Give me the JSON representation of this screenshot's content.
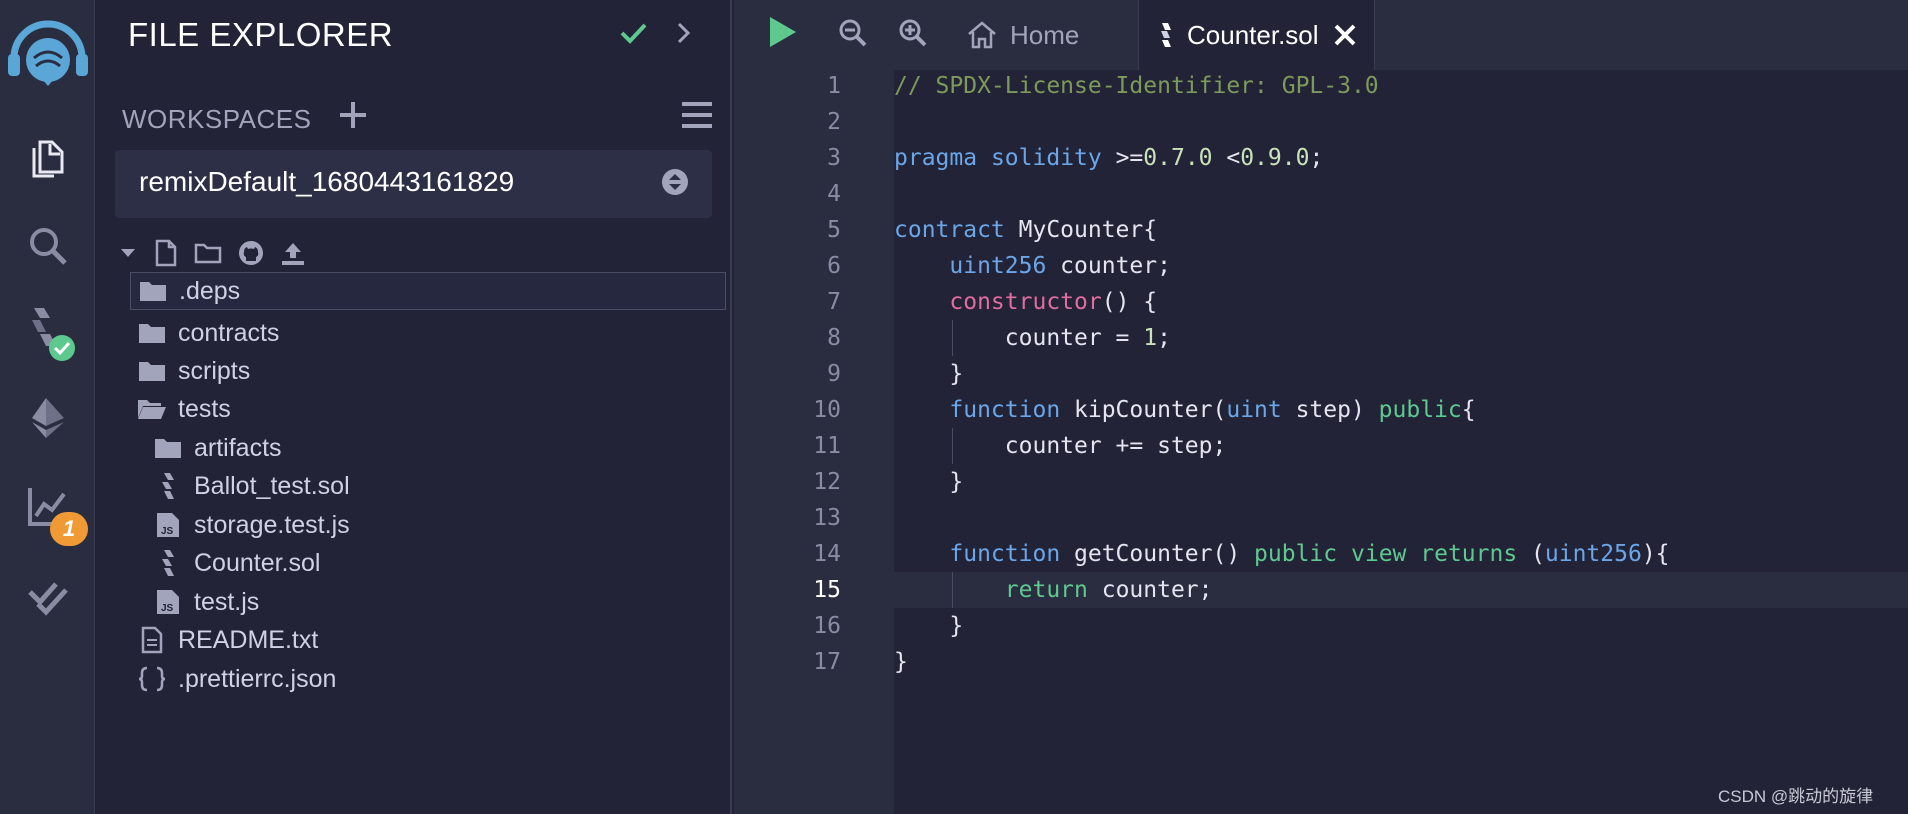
{
  "sidebar_icons": [
    {
      "name": "remix-logo-icon"
    },
    {
      "name": "file-explorer-icon"
    },
    {
      "name": "search-icon"
    },
    {
      "name": "solidity-compiler-icon"
    },
    {
      "name": "deploy-run-icon"
    },
    {
      "name": "analysis-icon",
      "badge": "1"
    },
    {
      "name": "tests-icon"
    }
  ],
  "explorer": {
    "title": "FILE EXPLORER",
    "workspaces_label": "WORKSPACES",
    "workspace_value": "remixDefault_1680443161829",
    "items": [
      {
        "label": ".deps",
        "type": "folder"
      },
      {
        "label": "contracts",
        "type": "folder"
      },
      {
        "label": "scripts",
        "type": "folder"
      },
      {
        "label": "tests",
        "type": "folder-open"
      },
      {
        "label": "artifacts",
        "type": "folder"
      },
      {
        "label": "Ballot_test.sol",
        "type": "sol"
      },
      {
        "label": "storage.test.js",
        "type": "js"
      },
      {
        "label": "Counter.sol",
        "type": "sol"
      },
      {
        "label": "test.js",
        "type": "js"
      },
      {
        "label": "README.txt",
        "type": "file"
      },
      {
        "label": ".prettierrc.json",
        "type": "json"
      }
    ]
  },
  "tabs": {
    "home": "Home",
    "active": "Counter.sol"
  },
  "editor": {
    "current_line": "15",
    "line_numbers": [
      "1",
      "2",
      "3",
      "4",
      "5",
      "6",
      "7",
      "8",
      "9",
      "10",
      "11",
      "12",
      "13",
      "14",
      "15",
      "16",
      "17"
    ]
  },
  "watermark": "CSDN @跳动的旋律",
  "colors": {
    "accent_green": "#5ec98e",
    "badge_orange": "#f09a35",
    "keyword_blue": "#6aa6e8",
    "keyword_pink": "#e06ca0"
  }
}
